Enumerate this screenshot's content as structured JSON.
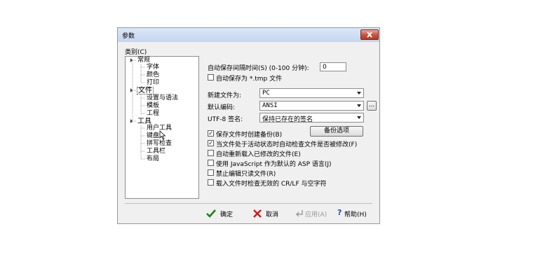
{
  "dialog": {
    "title": "参数"
  },
  "tree": {
    "label": "类别(C)",
    "groups": [
      {
        "name": "常规",
        "children": [
          "字体",
          "颜色",
          "打印"
        ]
      },
      {
        "name": "文件",
        "children": [
          "设置与语法",
          "模板",
          "工程"
        ]
      },
      {
        "name": "工具",
        "children": [
          "用户工具",
          "键盘",
          "拼写检查",
          "工具栏",
          "布局"
        ]
      }
    ]
  },
  "settings": {
    "autosave_label": "自动保存间隔时间(S) (0-100 分钟):",
    "autosave_value": "0",
    "autosave_tmp_label": "自动保存为 *.tmp 文件",
    "new_file_label": "新建文件为:",
    "new_file_value": "PC",
    "default_encoding_label": "默认编码:",
    "default_encoding_value": "ANSI",
    "encoding_more": "...",
    "utf8_sig_label": "UTF-8 签名:",
    "utf8_sig_value": "保持已存在的签名",
    "backup_options_button": "备份选项"
  },
  "options": [
    {
      "label": "保存文件时创建备份(B)",
      "checked": true
    },
    {
      "label": "当文件处于活动状态时自动检查文件是否被修改(F)",
      "checked": true
    },
    {
      "label": "自动重新载入已修改的文件(E)",
      "checked": false
    },
    {
      "label": "使用 JavaScript 作为默认的 ASP 语言(J)",
      "checked": false
    },
    {
      "label": "禁止编辑只读文件(R)",
      "checked": false
    },
    {
      "label": "载入文件时检查无效的 CR/LF 与空字符",
      "checked": false
    }
  ],
  "buttons": {
    "ok": "确定",
    "cancel": "取消",
    "apply": "应用(A)",
    "help": "帮助(H)"
  },
  "colors": {
    "ok_green": "#1e7d1e",
    "cancel_red": "#c81e1e",
    "help_blue": "#1d4fa6"
  }
}
